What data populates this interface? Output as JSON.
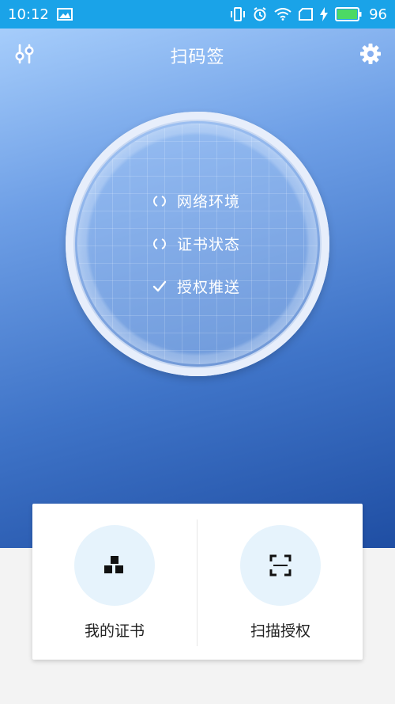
{
  "status_bar": {
    "time": "10:12",
    "battery": "96",
    "icons": [
      "image-icon",
      "vibrate-icon",
      "alarm-icon",
      "wifi-icon",
      "sim-icon",
      "charging-icon",
      "battery-icon"
    ]
  },
  "header": {
    "title": "扫码签",
    "left_icon": "filter-sliders-icon",
    "right_icon": "gear-icon"
  },
  "status_checks": [
    {
      "label": "网络环境",
      "state": "loading"
    },
    {
      "label": "证书状态",
      "state": "loading"
    },
    {
      "label": "授权推送",
      "state": "done"
    }
  ],
  "actions": [
    {
      "label": "我的证书",
      "icon": "certificate-blocks-icon"
    },
    {
      "label": "扫描授权",
      "icon": "scan-frame-icon"
    }
  ],
  "colors": {
    "status_bar": "#1aa3e8",
    "gradient_top": "#a6cdfb",
    "gradient_bottom": "#1f4ea3",
    "action_circle": "#e6f3fc",
    "battery_green": "#4cd964"
  }
}
